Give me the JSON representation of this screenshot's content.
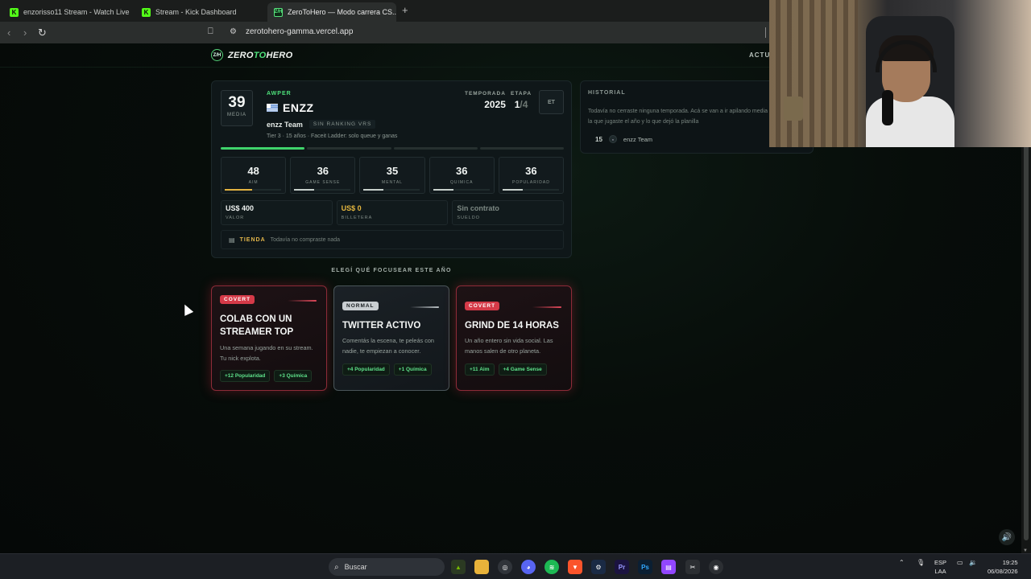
{
  "browser": {
    "tabs": [
      {
        "title": "enzorisso11 Stream - Watch Live",
        "favicon": "kick-logo"
      },
      {
        "title": "Stream - Kick Dashboard",
        "favicon": "kick-logo"
      },
      {
        "title": "ZeroToHero — Modo carrera CS...",
        "favicon": "zth-logo",
        "active": true
      }
    ],
    "url": "zerotohero-gamma.vercel.app"
  },
  "site": {
    "logo_badge": "Z/H",
    "logo_text_1": "ZERO",
    "logo_text_2": "TO",
    "logo_text_3": "HERO",
    "header_right": "ACTUA"
  },
  "player": {
    "media": "39",
    "media_label": "MEDIA",
    "role": "AWPER",
    "name": "ENZZ",
    "team": "enzz Team",
    "rank": "SIN RANKING VRS",
    "tier_info": "Tier 3 · 15 años · Faceit Ladder: solo queue y ganas",
    "season_label": "TEMPORADA",
    "season": "2025",
    "stage_label": "ETAPA",
    "stage_current": "1",
    "stage_total": "/4",
    "et_button": "ET",
    "progress": [
      true,
      false,
      false,
      false
    ],
    "stats": [
      {
        "value": "48",
        "label": "AIM",
        "fraction": 0.48,
        "gold": true
      },
      {
        "value": "36",
        "label": "GAME SENSE",
        "fraction": 0.36,
        "gold": false
      },
      {
        "value": "35",
        "label": "MENTAL",
        "fraction": 0.35,
        "gold": false
      },
      {
        "value": "36",
        "label": "QUIMICA",
        "fraction": 0.36,
        "gold": false
      },
      {
        "value": "36",
        "label": "POPULARIDAD",
        "fraction": 0.36,
        "gold": false
      }
    ],
    "money": [
      {
        "value": "US$ 400",
        "label": "VALOR",
        "style": "normal"
      },
      {
        "value": "US$ 0",
        "label": "BILLETERA",
        "style": "gold"
      },
      {
        "value": "Sin contrato",
        "label": "SUELDO",
        "style": "dim"
      }
    ],
    "shop_label": "TIENDA",
    "shop_desc": "Todavía no compraste nada"
  },
  "history": {
    "title": "HISTORIAL",
    "desc": "Todavía no cerraste ninguna temporada. Acá se van a ir apilando media con la que jugaste el año y lo que dejó la planilla",
    "entry_media": "15",
    "entry_team": "enzz Team"
  },
  "choose": {
    "title": "ELEGÍ QUÉ FOCUSEAR ESTE AÑO",
    "cards": [
      {
        "rarity": "COVERT",
        "title": "COLAB CON UN STREAMER TOP",
        "desc": "Una semana jugando en su stream. Tu nick explota.",
        "tags": [
          "+12 Popularidad",
          "+3 Química"
        ]
      },
      {
        "rarity": "NORMAL",
        "title": "TWITTER ACTIVO",
        "desc": "Comentás la escena, te peleás con nadie, te empiezan a conocer.",
        "tags": [
          "+4 Popularidad",
          "+1 Química"
        ]
      },
      {
        "rarity": "COVERT",
        "title": "GRIND DE 14 HORAS",
        "desc": "Un año entero sin vida social. Las manos salen de otro planeta.",
        "tags": [
          "+11 Aim",
          "+4 Game Sense"
        ]
      }
    ]
  },
  "taskbar": {
    "search_placeholder": "Buscar",
    "lang_1": "ESP",
    "lang_2": "LAA",
    "time": "19:25",
    "date": "06/08/2026"
  },
  "colors": {
    "accent_green": "#4ee07a",
    "gold": "#e6b83f",
    "covert_red": "#d53a48"
  }
}
